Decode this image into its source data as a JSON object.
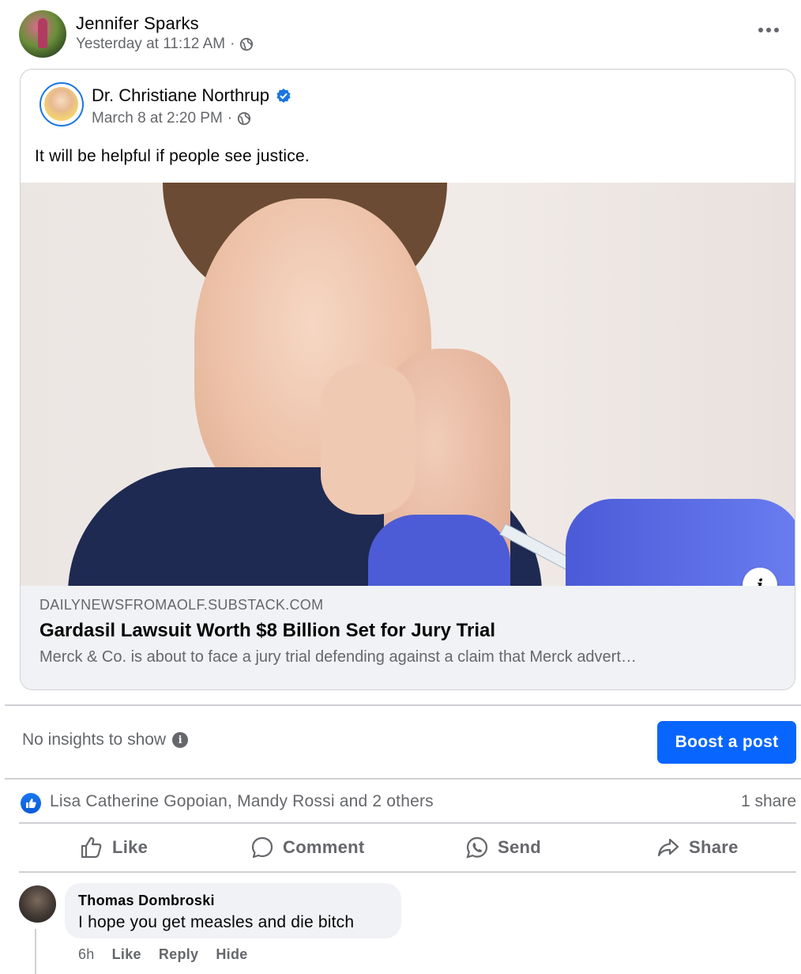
{
  "post": {
    "author": "Jennifer Sparks",
    "timestamp": "Yesterday at 11:12 AM",
    "separator": "·",
    "privacy_icon": "globe-icon",
    "more_icon": "more-options-icon"
  },
  "shared": {
    "author": "Dr. Christiane Northrup",
    "verified": true,
    "timestamp": "March 8 at 2:20 PM",
    "separator": "·",
    "text": "It will be helpful if people see justice."
  },
  "link": {
    "domain": "DAILYNEWSFROMAOLF.SUBSTACK.COM",
    "title": "Gardasil Lawsuit Worth $8 Billion Set for Jury Trial",
    "description": "Merck & Co. is about to face a jury trial defending against a claim that Merck advert…",
    "info_label": "i"
  },
  "insights": {
    "text": "No insights to show",
    "boost_label": "Boost a post"
  },
  "reactions": {
    "names": "Lisa Catherine Gopoian, Mandy Rossi and 2 others",
    "shares": "1 share"
  },
  "actions": {
    "like": "Like",
    "comment": "Comment",
    "send": "Send",
    "share": "Share"
  },
  "comment": {
    "author": "Thomas Dombroski",
    "text": "I hope you get measles and die bitch",
    "time": "6h",
    "like": "Like",
    "reply": "Reply",
    "hide": "Hide"
  },
  "colors": {
    "accent": "#0866ff",
    "verified": "#1b74e4",
    "secondary_text": "#65676b",
    "preview_bg": "#f0f2f5"
  }
}
